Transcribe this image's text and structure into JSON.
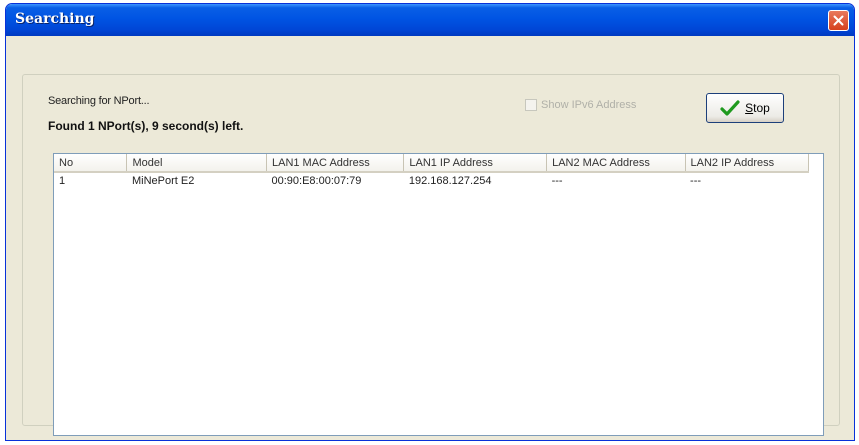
{
  "window": {
    "title": "Searching"
  },
  "status": {
    "searching_text": "Searching for NPort...",
    "found_text": "Found 1 NPort(s), 9 second(s) left."
  },
  "options": {
    "show_ipv6_label": "Show IPv6 Address",
    "show_ipv6_checked": false,
    "show_ipv6_enabled": false
  },
  "buttons": {
    "stop_label": "Stop",
    "stop_icon": "checkmark-icon",
    "close_icon": "close-icon"
  },
  "table": {
    "columns": [
      "No",
      "Model",
      "LAN1 MAC Address",
      "LAN1 IP Address",
      "LAN2 MAC Address",
      "LAN2 IP Address"
    ],
    "rows": [
      [
        "1",
        "MiNePort E2",
        "00:90:E8:00:07:79",
        "192.168.127.254",
        "---",
        "---"
      ]
    ]
  },
  "colors": {
    "titlebar": "#0054e3",
    "dialog_bg": "#ece9d8",
    "close_button": "#d6401e",
    "check_green": "#1f9a1f"
  }
}
